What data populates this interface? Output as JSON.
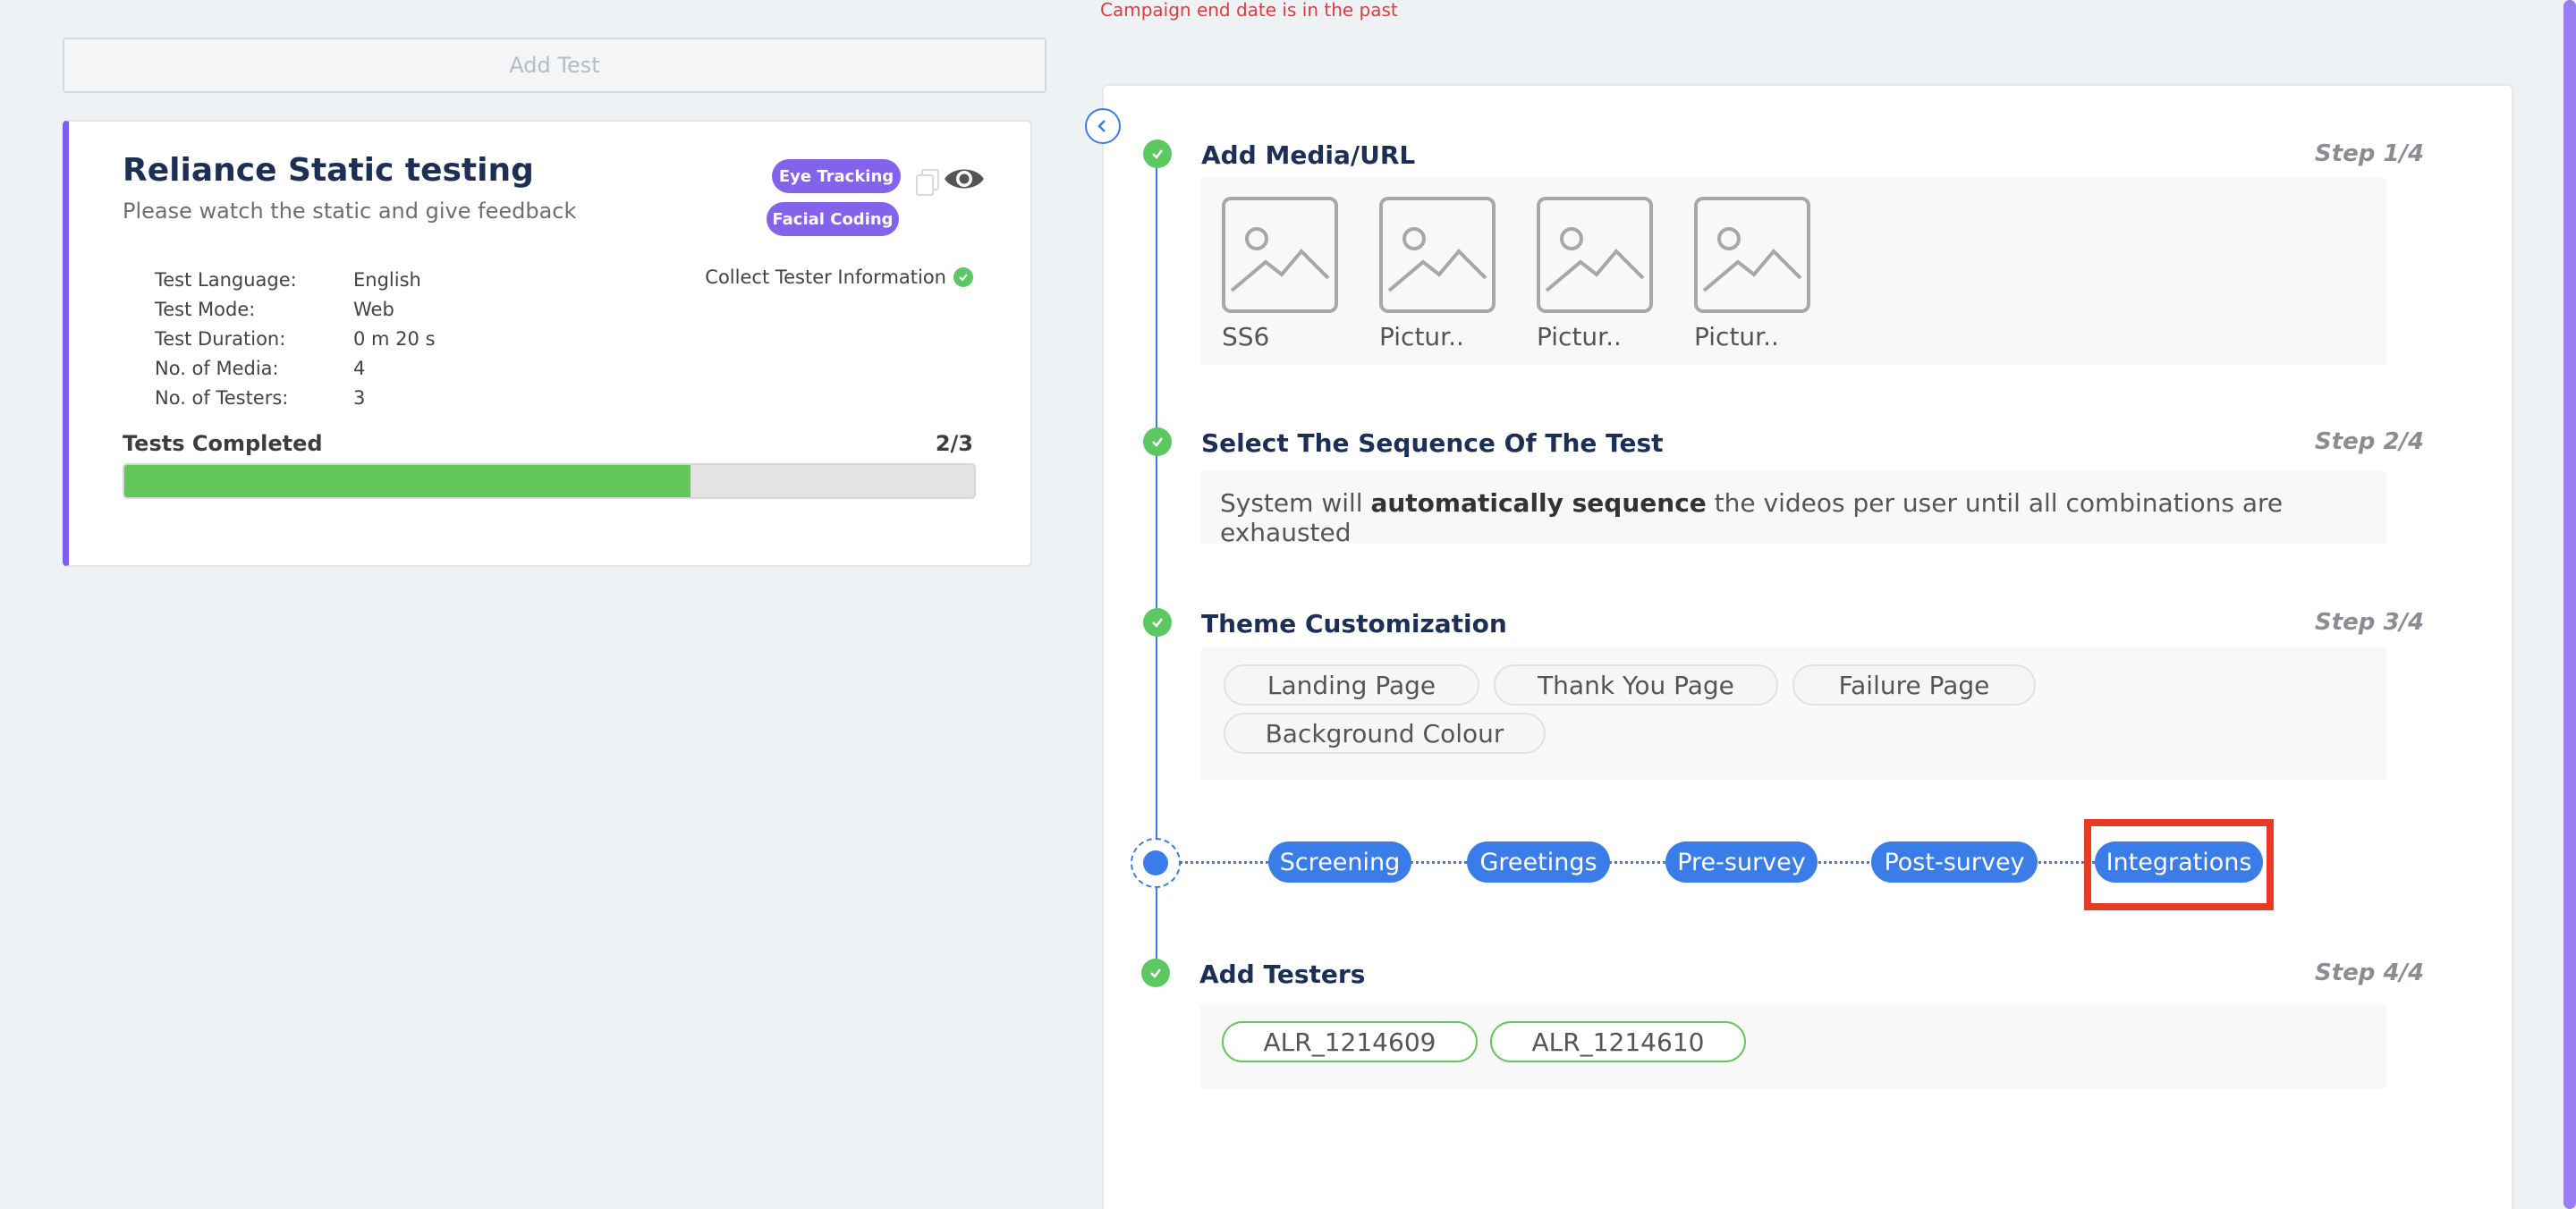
{
  "error_message": "Campaign end date is in the past",
  "add_test_label": "Add Test",
  "test_card": {
    "title": "Reliance Static testing",
    "subtitle": "Please watch the static and give feedback",
    "badges": [
      "Eye Tracking",
      "Facial Coding"
    ],
    "collect_tester_info": "Collect Tester Information",
    "info": [
      {
        "label": "Test Language:",
        "value": "English"
      },
      {
        "label": "Test Mode:",
        "value": "Web"
      },
      {
        "label": "Test Duration:",
        "value": "0 m 20 s"
      },
      {
        "label": "No. of Media:",
        "value": "4"
      },
      {
        "label": "No. of Testers:",
        "value": "3"
      }
    ],
    "tests_completed_label": "Tests Completed",
    "tests_completed_value": "2/3",
    "tests_completed_fraction": 0.6667
  },
  "steps": {
    "media": {
      "title": "Add Media/URL",
      "step": "Step 1/4",
      "items": [
        "SS6",
        "Pictur..",
        "Pictur..",
        "Pictur.."
      ]
    },
    "sequence": {
      "title": "Select The Sequence Of The Test",
      "step": "Step 2/4",
      "text_before": "System will ",
      "text_bold": "automatically sequence",
      "text_after": " the videos per user until all combinations are exhausted"
    },
    "theme": {
      "title": "Theme Customization",
      "step": "Step 3/4",
      "options": [
        "Landing Page",
        "Thank You Page",
        "Failure Page",
        "Background Colour"
      ]
    },
    "flow": [
      "Screening",
      "Greetings",
      "Pre-survey",
      "Post-survey",
      "Integrations"
    ],
    "testers": {
      "title": "Add Testers",
      "step": "Step 4/4",
      "items": [
        "ALR_1214609",
        "ALR_1214610"
      ]
    }
  },
  "colors": {
    "accent": "#3b7de8",
    "success": "#5bc861",
    "badge": "#8362ec",
    "highlight": "#e83a24"
  }
}
